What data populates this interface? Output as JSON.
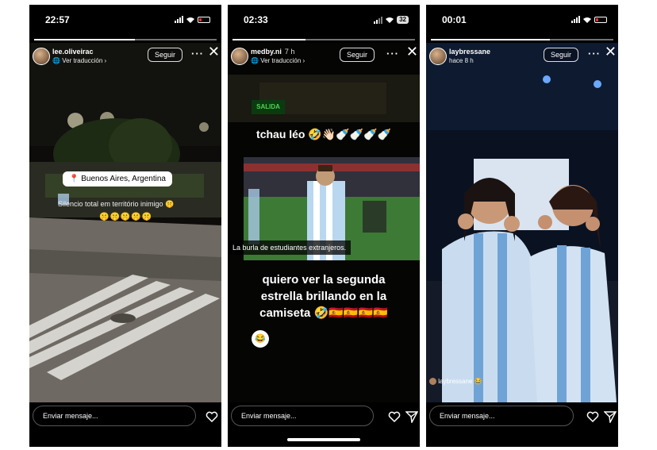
{
  "stories": [
    {
      "status": {
        "time": "22:57"
      },
      "progress": 0.55,
      "user": {
        "name": "lee.oliveirac",
        "age": "",
        "subtitle": "Ver traducción ›"
      },
      "follow_label": "Seguir",
      "more_label": "···",
      "close_label": "✕",
      "sticker_location": "Buenos Aires, Argentina",
      "overlay_text": "Silencio total em território inimigo",
      "overlay_emoji": "🤫",
      "emoji_row": "🤫🤫🤫🤫🤫",
      "message_placeholder": "Enviar mensaje..."
    },
    {
      "status": {
        "time": "02:33",
        "battery": "32"
      },
      "progress": 0.4,
      "user": {
        "name": "medby.ni",
        "age": "7 h",
        "subtitle": "Ver traducción ›"
      },
      "follow_label": "Seguir",
      "more_label": "···",
      "close_label": "✕",
      "sign_text": "SALIDA",
      "text_top": "tchau léo 🤣👋🏻🍼🍼🍼🍼",
      "caption": "La burla de estudiantes extranjeros.",
      "text_main_line1": "quiero ver la segunda",
      "text_main_line2": "estrella brillando en la",
      "text_main_line3": "camiseta 🤣🇪🇸🇪🇸🇪🇸🇪🇸",
      "reply_emoji": "😂",
      "message_placeholder": "Enviar mensaje..."
    },
    {
      "status": {
        "time": "00:01"
      },
      "progress": 0.65,
      "user": {
        "name": "laybressane",
        "age": "",
        "subtitle": "hace 8 h"
      },
      "follow_label": "Seguir",
      "more_label": "···",
      "close_label": "✕",
      "mention": "laybressane 😂",
      "message_placeholder": "Enviar mensaje..."
    }
  ]
}
